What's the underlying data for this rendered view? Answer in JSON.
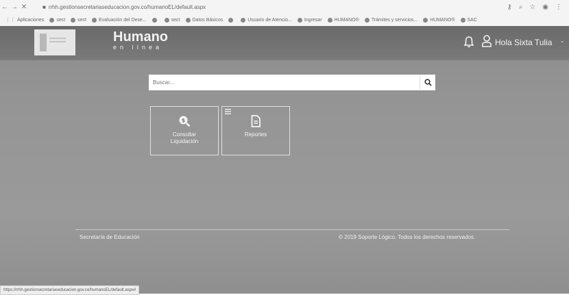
{
  "browser": {
    "nav": {
      "back": "←",
      "forward": "→",
      "reload": "✕"
    },
    "lock": "🔒",
    "url": "rrhh.gestionsecretariaseducacion.gov.co/humanoEL/default.aspx",
    "right_icons": [
      "key-icon",
      "search-icon",
      "star-icon",
      "profile-icon",
      "menu-icon"
    ],
    "bookmarks": [
      "Aplicaciones",
      "sect",
      "sect",
      "Evaluación del Dese...",
      "",
      "sect",
      "Datos Básicos",
      "",
      "Usuario de Atencio...",
      "Ingresar",
      "HUMANO®",
      "Trámites y servicios...",
      "HUMANO®",
      "SAC"
    ]
  },
  "header": {
    "brand": "Humano",
    "brand_sub": "en línea",
    "greeting": "Hola Sixta Tulia",
    "caret": "-"
  },
  "search": {
    "placeholder": "Buscar..."
  },
  "tiles": [
    {
      "label_line1": "Consultar",
      "label_line2": "Liquidación",
      "icon": "search-dollar-icon"
    },
    {
      "label": "Reportes",
      "icon": "document-icon"
    }
  ],
  "footer": {
    "left": "Secretaría de Educación",
    "right": "© 2019 Soporte Lógico. Todos los derechos reservados."
  },
  "status_bar": {
    "url": "https://rrhh.gestionsecretariaseducacion.gov.co/humanoEL/default.aspx#"
  },
  "colors": {
    "topbar": "#6f6f6f",
    "page_background": "#949494",
    "tile_border": "#e0e0e0",
    "text_light": "#f5f5f5"
  }
}
